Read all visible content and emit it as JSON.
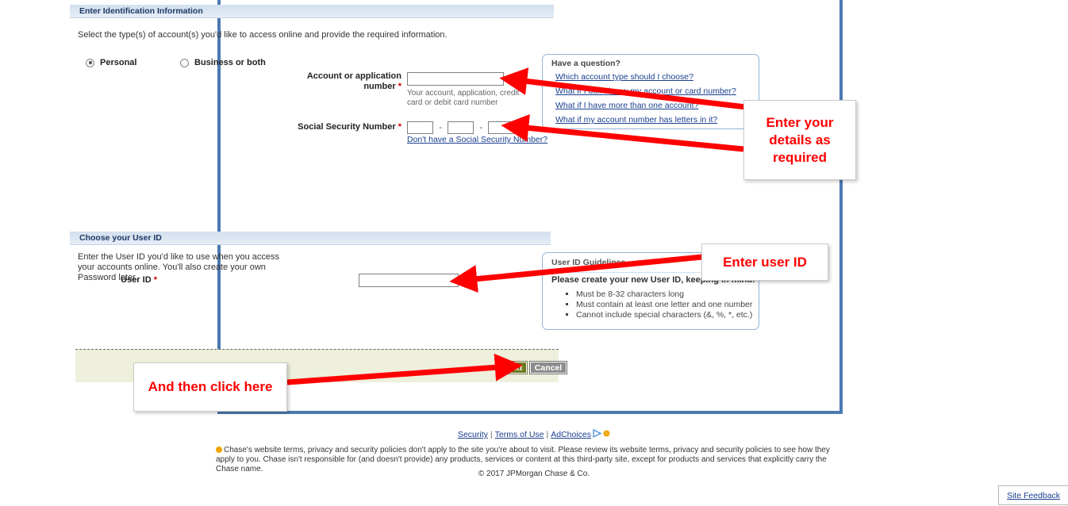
{
  "page": {
    "frame_border_color": "#4a7ab0",
    "accent_link_color": "#1a3f8f",
    "annotation_color": "#ff0000"
  },
  "identification_section": {
    "header": "Enter Identification Information",
    "intro": "Select the type(s) of account(s) you'd like to access online and provide the required information.",
    "account_type_options": [
      {
        "label": "Personal",
        "selected": true
      },
      {
        "label": "Business or both",
        "selected": false
      }
    ],
    "account_number_field": {
      "label": "Account or application number",
      "required_marker": "*",
      "value": "",
      "placeholder": "",
      "hint": "Your account, application, credit card or debit card number"
    },
    "ssn_field": {
      "label": "Social Security Number",
      "required_marker": "*",
      "part1": "",
      "part2": "",
      "part3": "",
      "separator": "-",
      "help_link": "Don't have a Social Security Number?"
    }
  },
  "have_a_question_panel": {
    "title": "Have a question?",
    "links": [
      "Which account type should I choose?",
      "What if I don't know my account or card number?",
      "What if I have more than one account?",
      "What if my account number has letters in it?"
    ]
  },
  "user_id_section": {
    "header": "Choose your User ID",
    "intro": "Enter the User ID you'd like to use when you access your accounts online. You'll also create your own Password later.",
    "user_id_field": {
      "label": "User ID",
      "required_marker": "*",
      "value": "",
      "placeholder": ""
    }
  },
  "user_id_guidelines_panel": {
    "title": "User ID Guidelines",
    "lead": "Please create your new User ID, keeping in mind:",
    "rules": [
      "Must be 8-32 characters long",
      "Must contain at least one letter and one number",
      "Cannot include special characters (&, %, *, etc.)"
    ]
  },
  "action_bar": {
    "next_label": "Next",
    "cancel_label": "Cancel",
    "next_color": "#6b7a1e",
    "cancel_color": "#8c8c8c"
  },
  "footer": {
    "links": [
      {
        "label": "Security"
      },
      {
        "label": "Terms of Use"
      },
      {
        "label": "AdChoices"
      }
    ],
    "separator": "|",
    "disclaimer": "Chase's website terms, privacy and security policies don't apply to the site you're about to visit. Please review its website terms, privacy and security policies to see how they apply to you. Chase isn't responsible for (and doesn't provide) any products, services or content at this third-party site, except for products and services that explicitly carry the Chase name.",
    "copyright": "© 2017 JPMorgan Chase & Co.",
    "site_feedback": "Site Feedback"
  },
  "annotations": [
    {
      "id": "details",
      "text": "Enter your details as required"
    },
    {
      "id": "userid",
      "text": "Enter user ID"
    },
    {
      "id": "click",
      "text": "And then click here"
    }
  ]
}
